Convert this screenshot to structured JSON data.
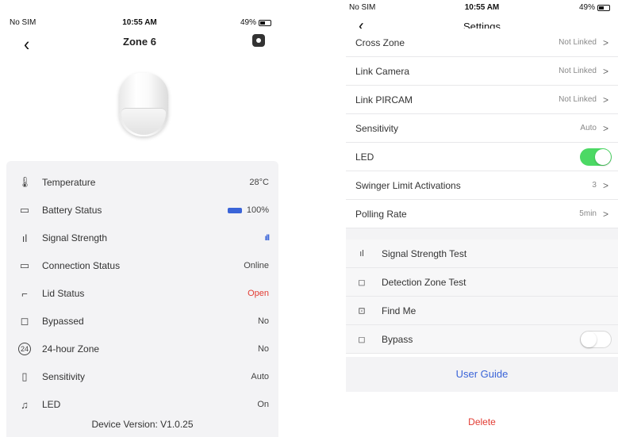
{
  "left": {
    "status": {
      "carrier": "No SIM",
      "time": "10:55 AM",
      "battery": "49%"
    },
    "nav": {
      "back": "‹",
      "title": "Zone 6"
    },
    "rows": [
      {
        "icon": "🌡",
        "label": "Temperature",
        "value": "28°C"
      },
      {
        "icon": "▭",
        "label": "Battery Status",
        "value": "100%"
      },
      {
        "icon": "ıl",
        "label": "Signal Strength",
        "value": "ıll"
      },
      {
        "icon": "▭",
        "label": "Connection Status",
        "value": "Online"
      },
      {
        "icon": "⌐",
        "label": "Lid Status",
        "value": "Open"
      },
      {
        "icon": "◻",
        "label": "Bypassed",
        "value": "No"
      },
      {
        "icon": "24",
        "label": "24-hour Zone",
        "value": "No"
      },
      {
        "icon": "▯",
        "label": "Sensitivity",
        "value": "Auto"
      },
      {
        "icon": "♫",
        "label": "LED",
        "value": "On"
      }
    ],
    "device_version": "Device Version: V1.0.25"
  },
  "right": {
    "status": {
      "carrier": "No SIM",
      "time": "10:55 AM",
      "battery": "49%"
    },
    "nav": {
      "back": "‹",
      "title": "Settings"
    },
    "settings": [
      {
        "label": "Cross Zone",
        "value": "Not Linked"
      },
      {
        "label": "Link Camera",
        "value": "Not Linked"
      },
      {
        "label": "Link PIRCAM",
        "value": "Not Linked"
      },
      {
        "label": "Sensitivity",
        "value": "Auto"
      },
      {
        "label": "LED",
        "toggle": "on"
      },
      {
        "label": "Swinger Limit Activations",
        "value": "3"
      },
      {
        "label": "Polling Rate",
        "value": "5min"
      }
    ],
    "tools": [
      {
        "icon": "ıl",
        "label": "Signal Strength Test"
      },
      {
        "icon": "◻",
        "label": "Detection Zone Test"
      },
      {
        "icon": "⊡",
        "label": "Find Me"
      },
      {
        "icon": "◻",
        "label": "Bypass",
        "toggle": "off"
      }
    ],
    "user_guide": "User Guide",
    "delete": "Delete",
    "chevron": ">"
  }
}
